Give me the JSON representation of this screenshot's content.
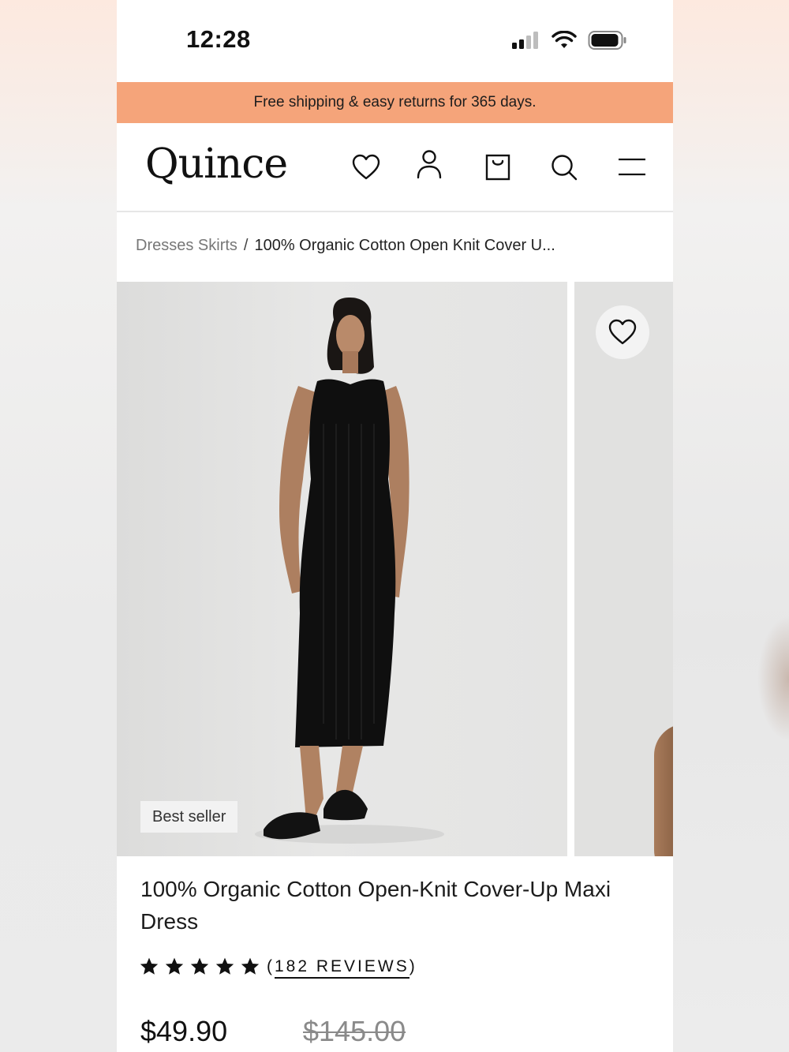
{
  "status_bar": {
    "time": "12:28"
  },
  "promo": {
    "text": "Free shipping & easy returns for 365 days."
  },
  "header": {
    "logo": "Quince",
    "icons": [
      "heart-icon",
      "user-icon",
      "shopping-bag-icon",
      "search-icon",
      "menu-icon"
    ]
  },
  "breadcrumb": {
    "parent": "Dresses Skirts",
    "separator": "/",
    "current": "100% Organic Cotton Open Knit Cover U..."
  },
  "gallery": {
    "badge": "Best seller"
  },
  "product": {
    "title": "100% Organic Cotton Open-Knit Cover-Up Maxi Dress",
    "rating": 5,
    "reviews_open": "(",
    "reviews_label": "182 REVIEWS",
    "reviews_close": ")",
    "price": "$49.90",
    "original_price": "$145.00"
  },
  "colors": {
    "promo_bg": "#f5a47a",
    "text": "#111111"
  }
}
